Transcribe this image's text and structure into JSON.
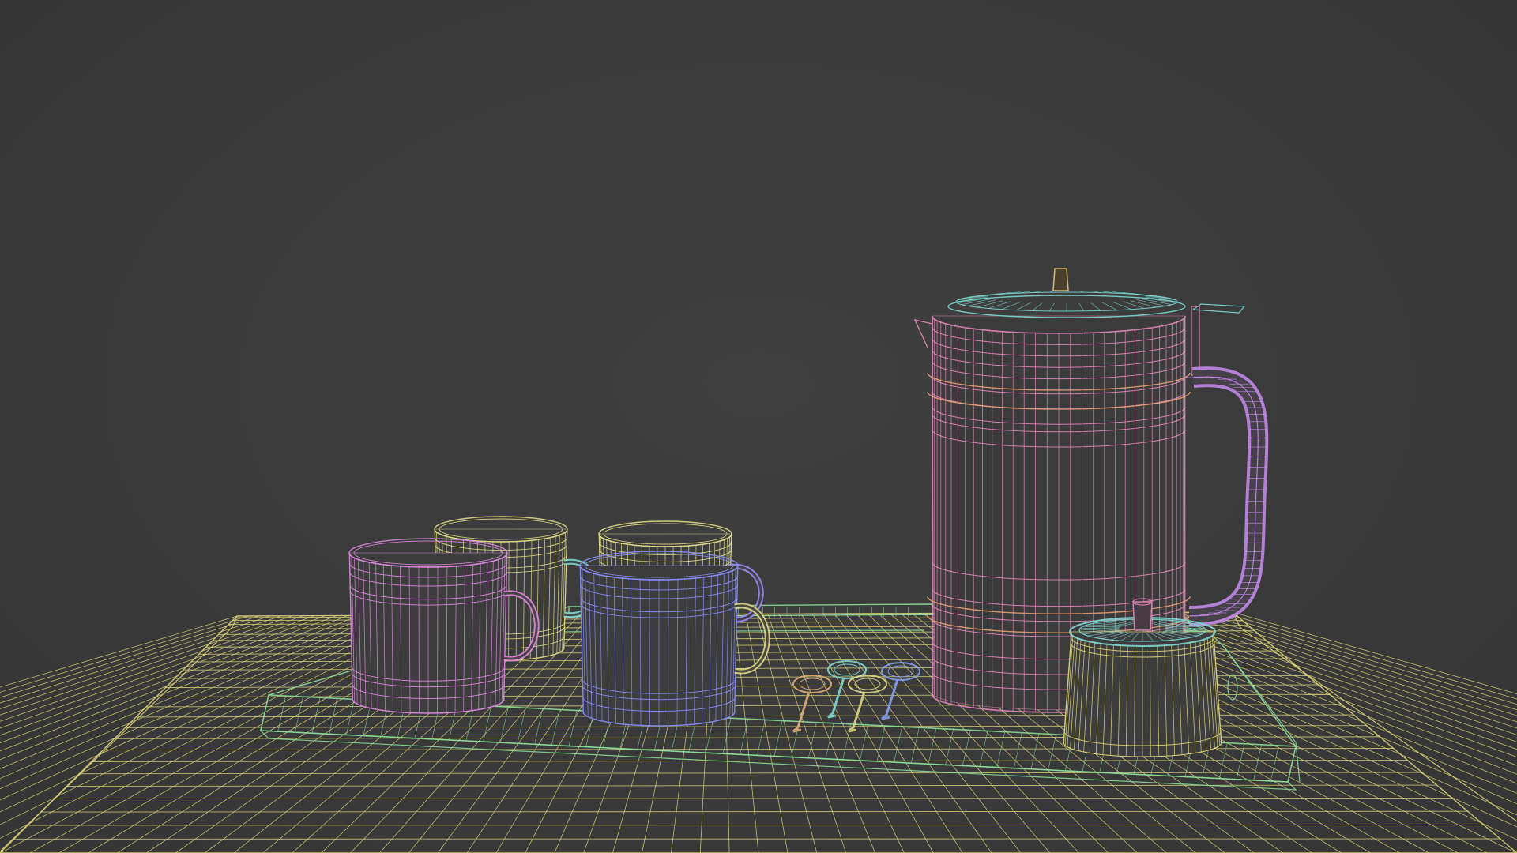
{
  "scene": {
    "view": "wireframe",
    "background_color": "#3a3a3a",
    "objects": [
      {
        "id": "table-surface",
        "wire_color": "#d8d27a"
      },
      {
        "id": "tray",
        "wire_color": "#8fd89a"
      },
      {
        "id": "mug-back-left",
        "wire_color": "#dcd888",
        "handle_color": "#7fd8d0"
      },
      {
        "id": "mug-back-right",
        "wire_color": "#dcd888",
        "handle_color": "#9b8cf0"
      },
      {
        "id": "mug-front-left",
        "wire_color": "#d58ad8",
        "handle_color": "#e08ad8"
      },
      {
        "id": "mug-front-right",
        "wire_color": "#8a8cf0",
        "handle_color": "#dcd888"
      },
      {
        "id": "coffee-pot",
        "wire_color": "#e08ab8",
        "lid_color": "#7fd8d0",
        "knob_color": "#e0c27a",
        "handle_color": "#c08ae8"
      },
      {
        "id": "sugar-bowl",
        "wire_color": "#d8d27a",
        "lid_color": "#7fd8d0",
        "knob_color": "#e08ab8"
      },
      {
        "id": "spoons",
        "count": 4,
        "colors": [
          "#e0b07a",
          "#7fd8d0",
          "#dcd888",
          "#8aa0f0"
        ]
      }
    ]
  }
}
